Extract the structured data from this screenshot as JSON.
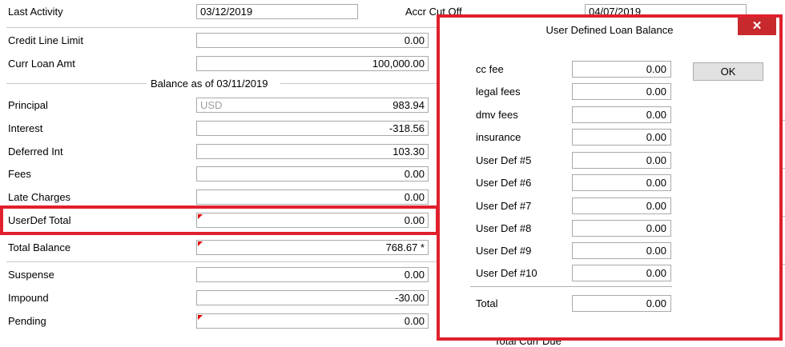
{
  "top": {
    "last_activity_label": "Last Activity",
    "last_activity_value": "03/12/2019",
    "accr_cut_off_label": "Accr Cut Off",
    "accr_cut_off_value": "04/07/2019"
  },
  "credit_line_limit": {
    "label": "Credit Line Limit",
    "value": "0.00"
  },
  "curr_loan_amt": {
    "label": "Curr Loan Amt",
    "value": "100,000.00"
  },
  "balance_header": "Balance as of 03/11/2019",
  "principal": {
    "label": "Principal",
    "currency": "USD",
    "value": "983.94"
  },
  "interest": {
    "label": "Interest",
    "value": "-318.56"
  },
  "deferred_int": {
    "label": "Deferred Int",
    "value": "103.30"
  },
  "fees": {
    "label": "Fees",
    "value": "0.00"
  },
  "late_charges": {
    "label": "Late Charges",
    "value": "0.00"
  },
  "userdef_total": {
    "label": "UserDef Total",
    "value": "0.00"
  },
  "total_balance": {
    "label": "Total Balance",
    "value": "768.67 *"
  },
  "suspense": {
    "label": "Suspense",
    "value": "0.00"
  },
  "impound": {
    "label": "Impound",
    "value": "-30.00"
  },
  "pending": {
    "label": "Pending",
    "value": "0.00"
  },
  "bottom_partial_label": "Total Curr Due",
  "dialog": {
    "title": "User Defined Loan Balance",
    "close_glyph": "✕",
    "ok_label": "OK",
    "rows": [
      {
        "label": "cc fee",
        "value": "0.00"
      },
      {
        "label": "legal fees",
        "value": "0.00"
      },
      {
        "label": "dmv fees",
        "value": "0.00"
      },
      {
        "label": "insurance",
        "value": "0.00"
      },
      {
        "label": "User Def #5",
        "value": "0.00"
      },
      {
        "label": "User Def #6",
        "value": "0.00"
      },
      {
        "label": "User Def #7",
        "value": "0.00"
      },
      {
        "label": "User Def #8",
        "value": "0.00"
      },
      {
        "label": "User Def #9",
        "value": "0.00"
      },
      {
        "label": "User Def #10",
        "value": "0.00"
      }
    ],
    "total": {
      "label": "Total",
      "value": "0.00"
    }
  },
  "colors": {
    "highlight": "#e0202c",
    "close_button": "#c8292c",
    "flag": "#e00000"
  }
}
